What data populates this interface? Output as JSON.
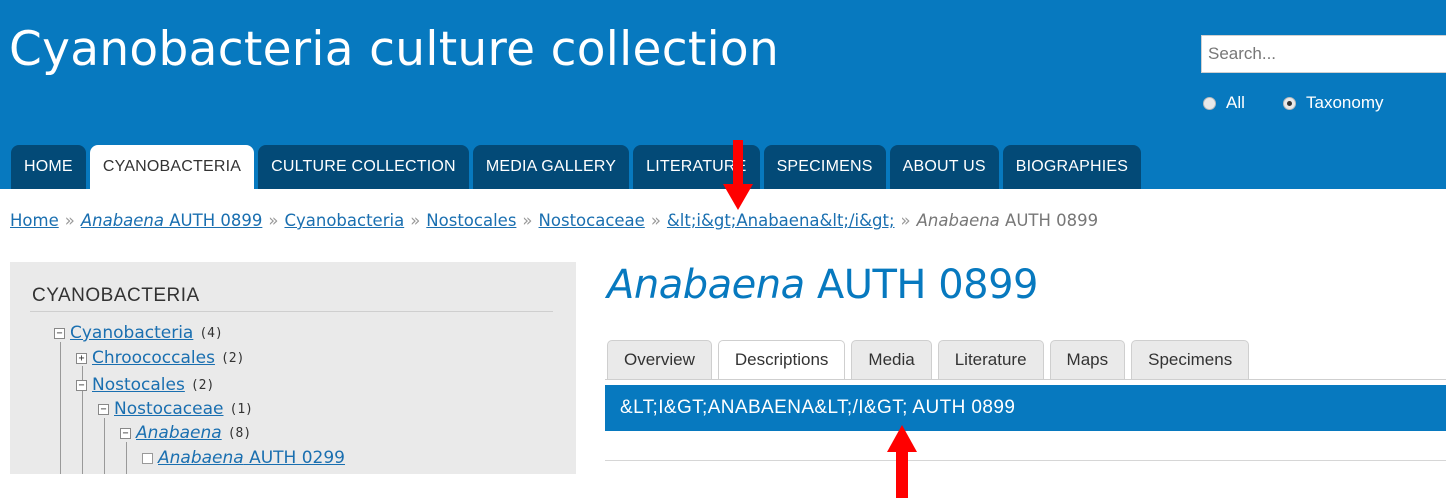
{
  "header": {
    "site_title": "Cyanobacteria culture collection",
    "search_placeholder": "Search...",
    "search_scope": [
      {
        "label": "All",
        "checked": false
      },
      {
        "label": "Taxonomy",
        "checked": true
      }
    ],
    "background_color": "#0779bf"
  },
  "main_tabs": [
    {
      "label": "HOME",
      "active": false
    },
    {
      "label": "CYANOBACTERIA",
      "active": true
    },
    {
      "label": "CULTURE COLLECTION",
      "active": false
    },
    {
      "label": "MEDIA GALLERY",
      "active": false
    },
    {
      "label": "LITERATURE",
      "active": false
    },
    {
      "label": "SPECIMENS",
      "active": false
    },
    {
      "label": "ABOUT US",
      "active": false
    },
    {
      "label": "BIOGRAPHIES",
      "active": false
    }
  ],
  "breadcrumb": {
    "home": "Home",
    "sep": "»",
    "item1_italic": "Anabaena",
    "item1_rest": " AUTH 0899",
    "item2": "Cyanobacteria",
    "item3": "Nostocales",
    "item4": "Nostocaceae",
    "item5": "&lt;i&gt;Anabaena&lt;/i&gt;",
    "current_italic": "Anabaena",
    "current_rest": " AUTH 0899"
  },
  "sidebar": {
    "title": "CYANOBACTERIA",
    "tree": [
      {
        "label": "Cyanobacteria",
        "count": "(4)",
        "toggle": "−",
        "italic": false
      },
      {
        "label": "Chroococcales",
        "count": "(2)",
        "toggle": "+",
        "italic": false
      },
      {
        "label": "Nostocales",
        "count": "(2)",
        "toggle": "−",
        "italic": false
      },
      {
        "label": "Nostocaceae",
        "count": "(1)",
        "toggle": "−",
        "italic": false
      },
      {
        "label": "Anabaena",
        "count": "(8)",
        "toggle": "−",
        "italic": true
      },
      {
        "label_italic": "Anabaena",
        "label_rest": " AUTH 0299",
        "toggle": "",
        "italic": true
      }
    ]
  },
  "content": {
    "title_italic": "Anabaena",
    "title_rest": " AUTH 0899",
    "tabs": [
      {
        "label": "Overview",
        "active": false
      },
      {
        "label": "Descriptions",
        "active": true
      },
      {
        "label": "Media",
        "active": false
      },
      {
        "label": "Literature",
        "active": false
      },
      {
        "label": "Maps",
        "active": false
      },
      {
        "label": "Specimens",
        "active": false
      }
    ],
    "description_heading": "&LT;I&GT;ANABAENA&LT;/I&GT; AUTH 0899"
  },
  "annotations": {
    "arrow_color": "#ff0000",
    "arrows": [
      "arrow-down-icon",
      "arrow-up-icon"
    ]
  }
}
